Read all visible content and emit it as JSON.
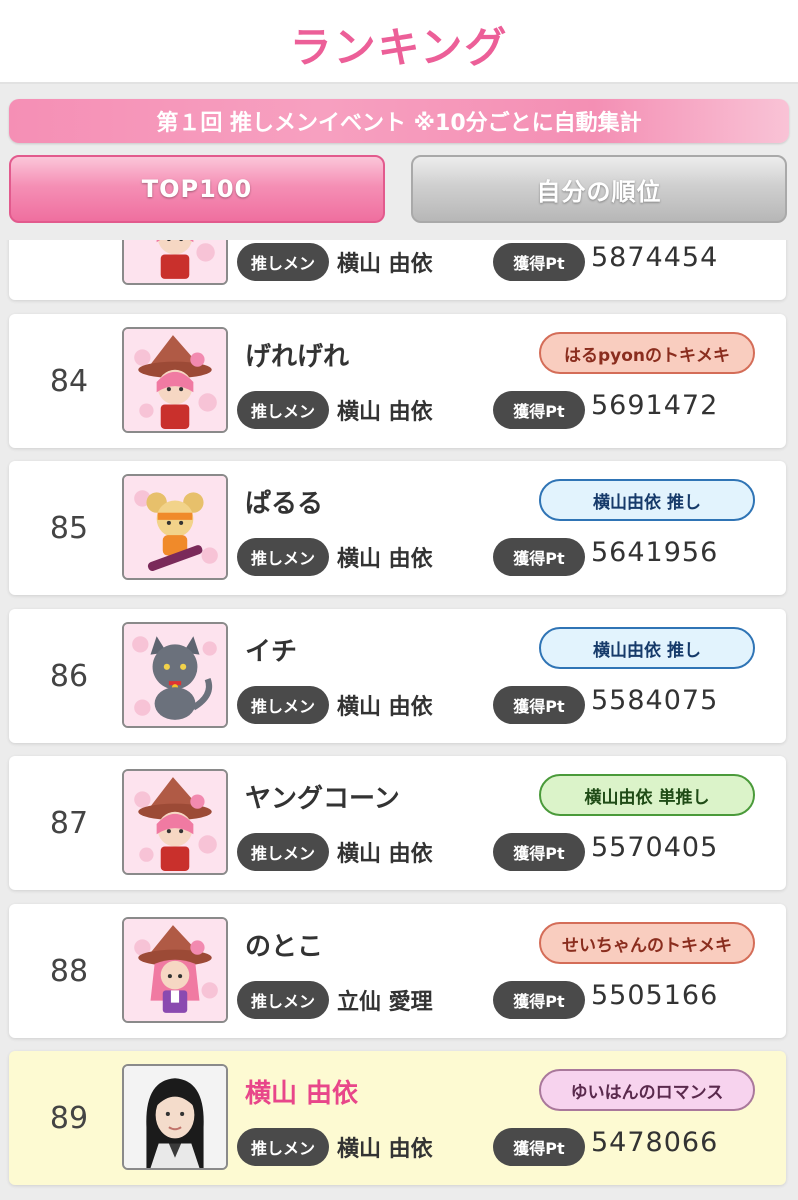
{
  "header": {
    "title": "ランキング"
  },
  "banner": {
    "text": "第１回 推しメンイベント ※10分ごとに自動集計"
  },
  "tabs": [
    {
      "label": "TOP100",
      "active": true
    },
    {
      "label": "自分の順位",
      "active": false
    }
  ],
  "labels": {
    "oshi_label": "推しメン",
    "points_label": "獲得Pt"
  },
  "rows": [
    {
      "rank": "",
      "name": "",
      "member": "横山 由依",
      "points": "5874454",
      "tag": "",
      "avatar": "witch-character-icon"
    },
    {
      "rank": "84",
      "name": "げれげれ",
      "member": "横山 由依",
      "points": "5691472",
      "tag": "はるpyonのトキメキ",
      "tag_style": "tokimeki",
      "avatar": "witch-character-icon"
    },
    {
      "rank": "85",
      "name": "ぱるる",
      "member": "横山 由依",
      "points": "5641956",
      "tag": "横山由依 推し",
      "tag_style": "oshi",
      "avatar": "mouse-character-icon"
    },
    {
      "rank": "86",
      "name": "イチ",
      "member": "横山 由依",
      "points": "5584075",
      "tag": "横山由依 推し",
      "tag_style": "oshi",
      "avatar": "cat-character-icon"
    },
    {
      "rank": "87",
      "name": "ヤングコーン",
      "member": "横山 由依",
      "points": "5570405",
      "tag": "横山由依 単推し",
      "tag_style": "tanoshi",
      "avatar": "witch-character-icon"
    },
    {
      "rank": "88",
      "name": "のとこ",
      "member": "立仙 愛理",
      "points": "5505166",
      "tag": "せいちゃんのトキメキ",
      "tag_style": "tokimeki",
      "avatar": "witch-girl-character-icon"
    },
    {
      "rank": "89",
      "name": "横山 由依",
      "member": "横山 由依",
      "points": "5478066",
      "tag": "ゆいはんのロマンス",
      "tag_style": "romance",
      "avatar": "member-photo",
      "highlight": true
    }
  ],
  "colors": {
    "accent_pink": "#ec5f98",
    "highlight_row": "#fdfad2",
    "pill_dark": "#4a4a4a"
  }
}
